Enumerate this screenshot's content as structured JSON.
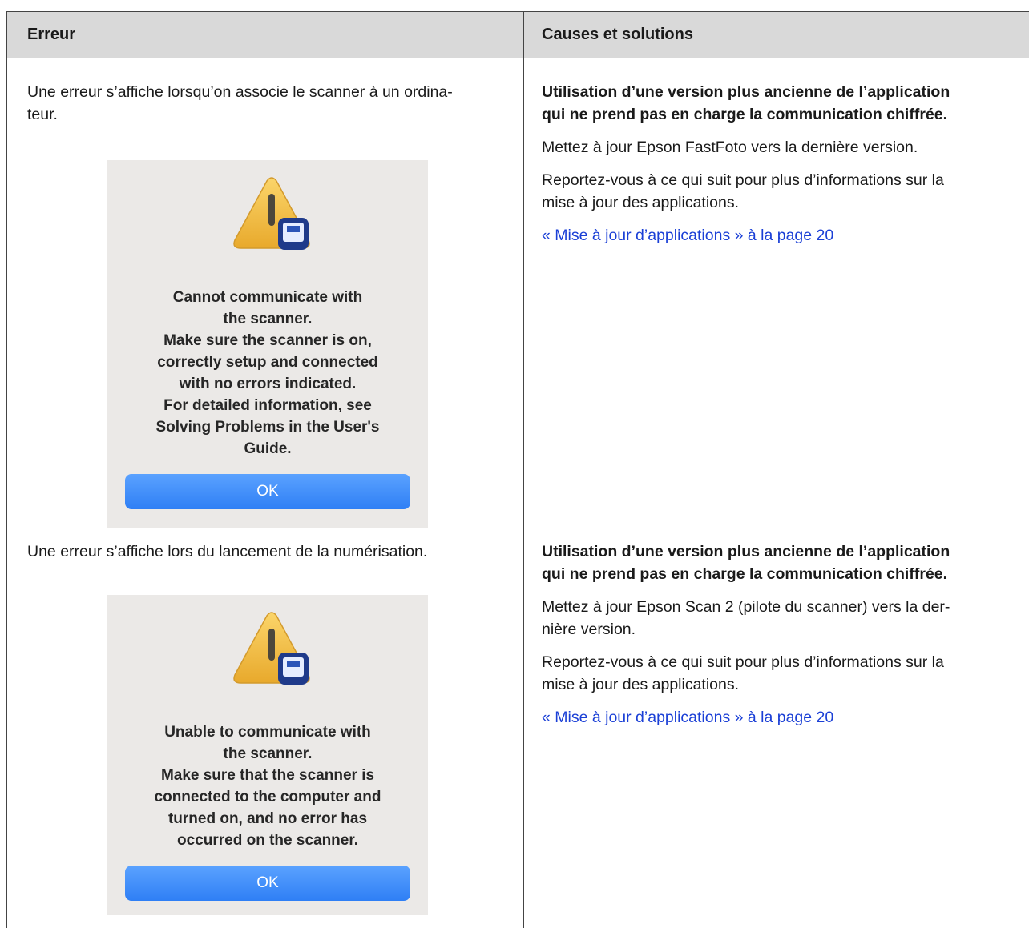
{
  "header": {
    "col1": "Erreur",
    "col2": "Causes et solutions"
  },
  "rows": [
    {
      "error_lines": [
        "Une erreur s’affiche lorsqu’on associe le scanner à un ordina-",
        "teur."
      ],
      "dialog": {
        "message_lines": [
          "Cannot communicate with",
          "the scanner.",
          "Make sure the scanner is on,",
          "correctly setup and connected",
          "with no errors indicated.",
          "For detailed information, see",
          "Solving Problems in the User's",
          "Guide."
        ],
        "ok_label": "OK"
      },
      "cause_lines": [
        "Utilisation d’une version plus ancienne de l’application",
        "qui ne prend pas en charge la communication chiffrée."
      ],
      "solution": "Mettez à jour Epson FastFoto vers la dernière version.",
      "see_lines": [
        "Reportez-vous à ce qui suit pour plus d’informations sur la",
        "mise à jour des applications."
      ],
      "link": "« Mise à jour d’applications » à la page 20"
    },
    {
      "error_lines": [
        "Une erreur s’affiche lors du lancement de la numérisation."
      ],
      "dialog": {
        "message_lines": [
          "Unable to communicate with",
          "the scanner.",
          "Make sure that the scanner is",
          "connected to the computer and",
          "turned on, and no error has",
          "occurred on the scanner."
        ],
        "ok_label": "OK"
      },
      "cause_lines": [
        "Utilisation d’une version plus ancienne de l’application",
        "qui ne prend pas en charge la communication chiffrée."
      ],
      "solution_lines": [
        "Mettez à jour Epson Scan 2 (pilote du scanner) vers la der-",
        "nière version."
      ],
      "see_lines": [
        "Reportez-vous à ce qui suit pour plus d’informations sur la",
        "mise à jour des applications."
      ],
      "link": "« Mise à jour d’applications » à la page 20"
    }
  ]
}
